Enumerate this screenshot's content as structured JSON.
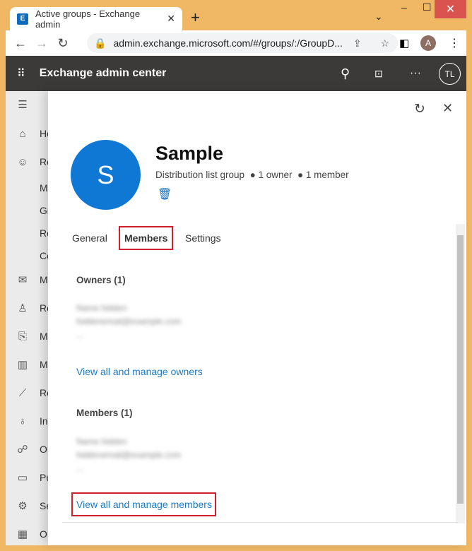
{
  "browser": {
    "tab_title": "Active groups - Exchange admin",
    "favicon": "E",
    "url": "admin.exchange.microsoft.com/#/groups/:/GroupD...",
    "profile": "A"
  },
  "header": {
    "title": "Exchange admin center",
    "user_initials": "TL"
  },
  "sidebar": {
    "items": [
      "Ho",
      "Re",
      "M",
      "Gr",
      "Re",
      "Co",
      "M",
      "Ro",
      "M",
      "M",
      "Re",
      "In",
      "O",
      "Pu",
      "Se",
      "O"
    ]
  },
  "group": {
    "initial": "S",
    "name": "Sample",
    "type": "Distribution list group",
    "owners": "1 owner",
    "members": "1 member"
  },
  "tabs": [
    "General",
    "Members",
    "Settings"
  ],
  "owners": {
    "heading": "Owners (1)",
    "name": "Name hidden",
    "email": "hiddenemail@example.com",
    "extra": "...",
    " link": "",
    "link_label": "View all and manage owners"
  },
  "members": {
    "heading": "Members (1)",
    "name": "Name hidden",
    "email": "hiddenemail@example.com",
    "extra": "...",
    "link_label": "View all and manage members"
  },
  "colors": {
    "accent": "#0f78d4",
    "highlight": "#d0202e",
    "link": "#1b7bc4"
  }
}
